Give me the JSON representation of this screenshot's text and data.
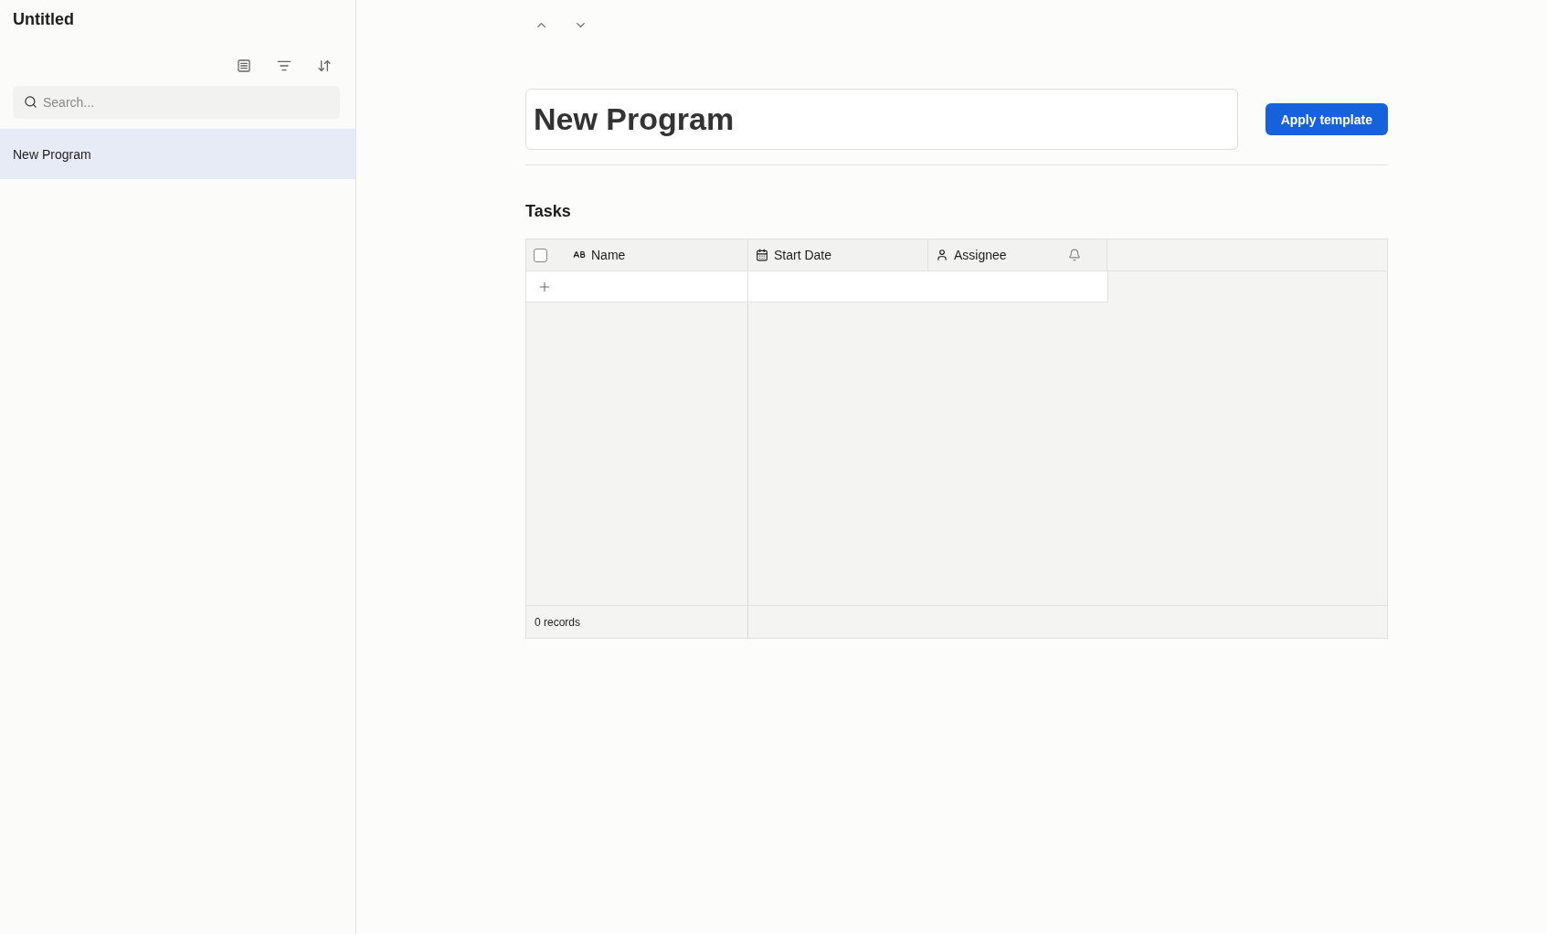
{
  "sidebar": {
    "title": "Untitled",
    "search": {
      "placeholder": "Search..."
    },
    "items": [
      {
        "label": "New Program",
        "selected": true
      }
    ]
  },
  "record": {
    "title": "New Program",
    "apply_button": "Apply template"
  },
  "tasks": {
    "heading": "Tasks",
    "select_all": {
      "checked": false
    },
    "columns": [
      {
        "label": "Name",
        "kind": "text"
      },
      {
        "label": "Start Date",
        "kind": "date"
      },
      {
        "label": "Assignee",
        "kind": "person"
      }
    ],
    "footer": "0 records"
  }
}
